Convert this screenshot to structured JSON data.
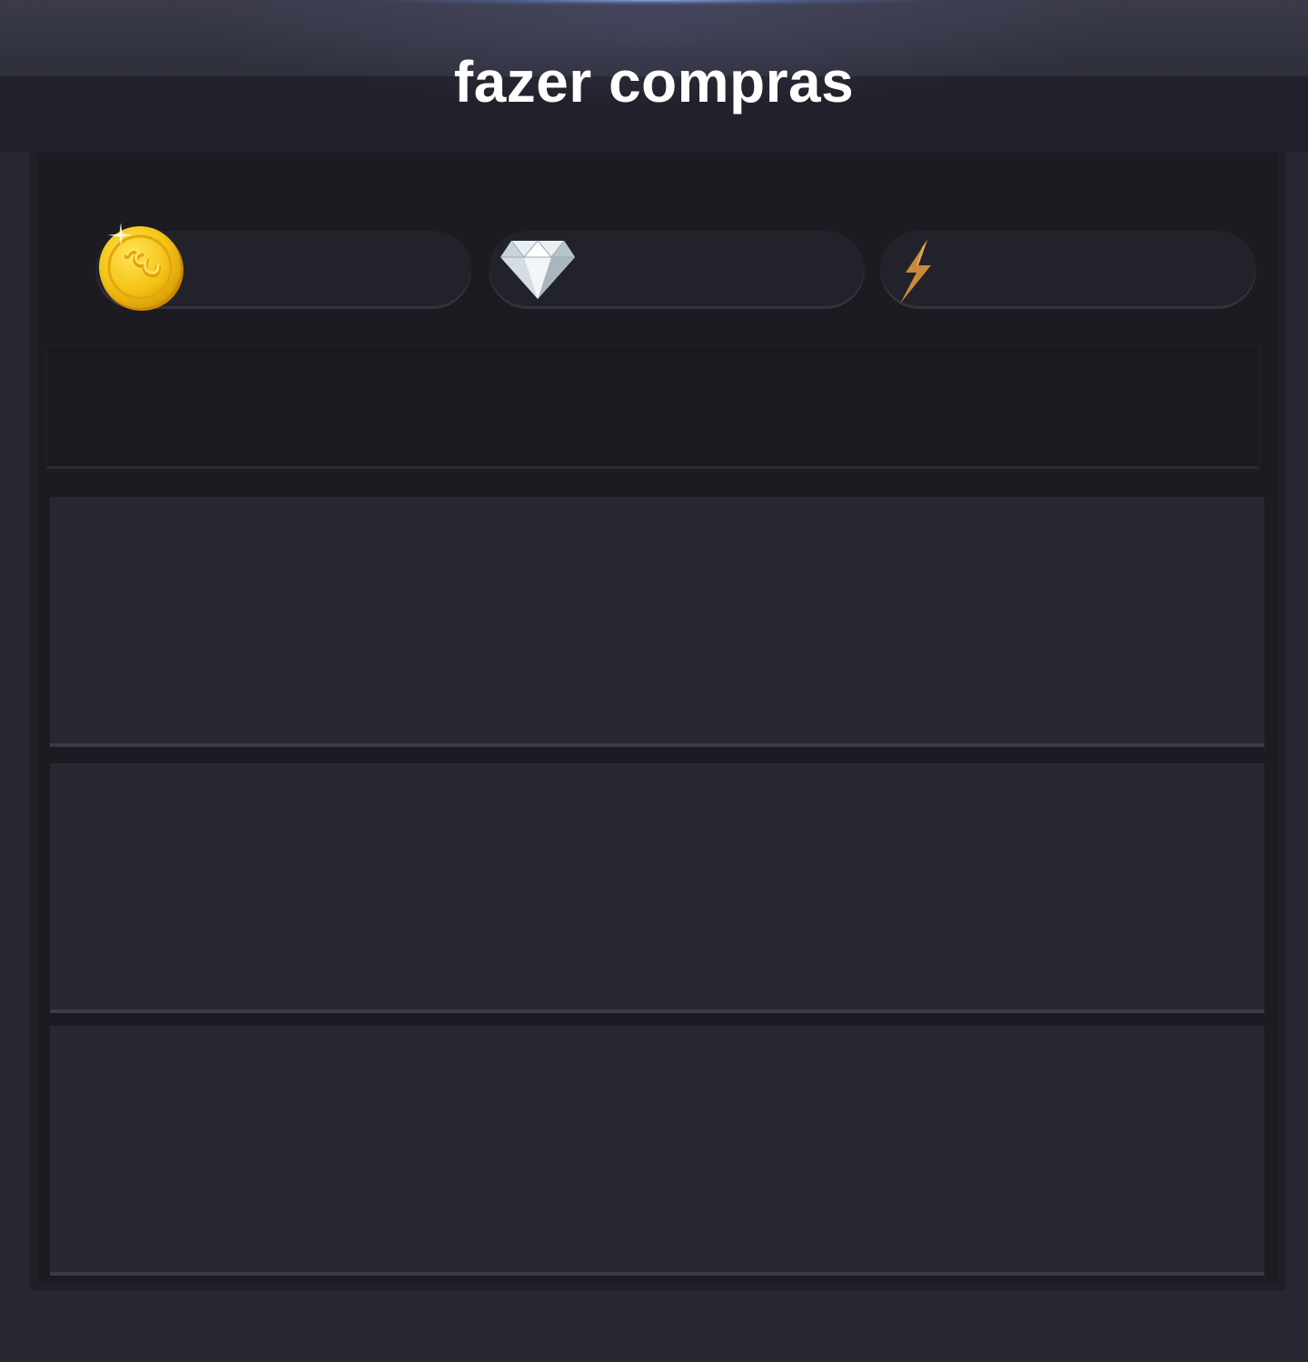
{
  "header": {
    "title": "fazer compras"
  },
  "currencies": [
    {
      "icon": "gold-coin-icon",
      "value": ""
    },
    {
      "icon": "diamond-icon",
      "value": ""
    },
    {
      "icon": "lightning-bolt-icon",
      "value": ""
    }
  ],
  "colors": {
    "background": "#272731",
    "panel": "#1b1b21",
    "card": "#282833",
    "title_text": "#ffffff",
    "coin_gold": "#f2c01e",
    "bolt_orange": "#c88a3a"
  }
}
